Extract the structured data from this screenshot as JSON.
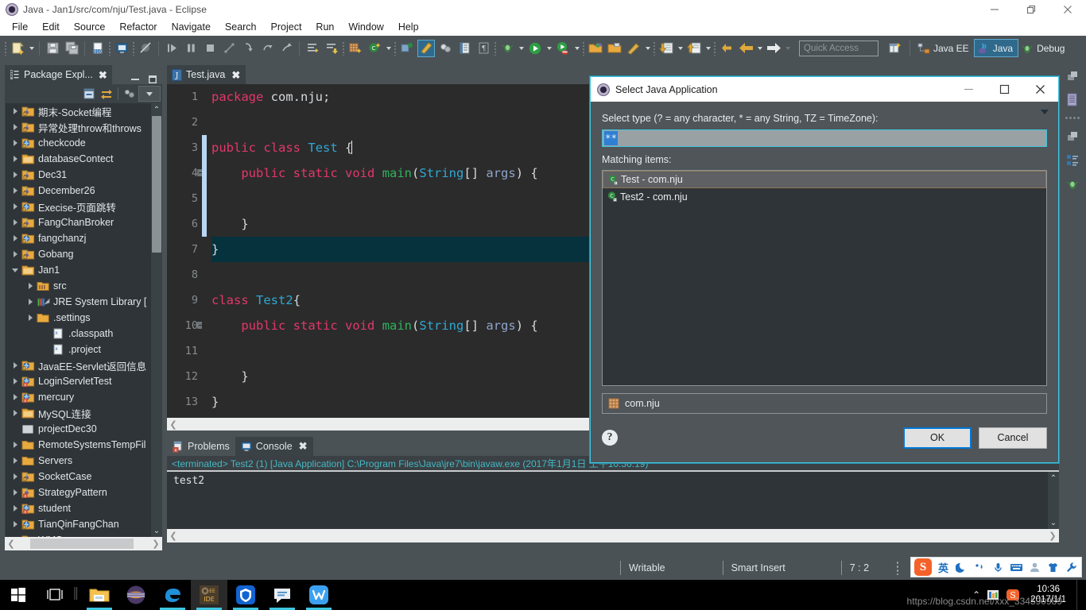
{
  "window": {
    "title": "Java - Jan1/src/com/nju/Test.java - Eclipse",
    "icon": "eclipse-icon",
    "minimize": "minimize-icon",
    "restore": "restore-icon",
    "close": "close-icon"
  },
  "menubar": {
    "items": [
      "File",
      "Edit",
      "Source",
      "Refactor",
      "Navigate",
      "Search",
      "Project",
      "Run",
      "Window",
      "Help"
    ]
  },
  "toolbar": {
    "quick_access_placeholder": "Quick Access",
    "perspectives": [
      {
        "label": "Java EE",
        "icon": "javaee-perspective-icon",
        "active": false
      },
      {
        "label": "Java",
        "icon": "java-perspective-icon",
        "active": true
      },
      {
        "label": "Debug",
        "icon": "debug-perspective-icon",
        "active": false
      }
    ],
    "open_perspective_icon": "open-perspective-icon"
  },
  "package_explorer": {
    "tab_label": "Package Expl...",
    "tab_icon": "package-explorer-icon",
    "close_icon": "close-icon",
    "minimize_icon": "minimize-icon",
    "maximize_icon": "maximize-icon",
    "tools": [
      "collapse-all-icon",
      "link-with-editor-icon",
      "view-menu-icon",
      "view-dropdown-icon"
    ],
    "tree": [
      {
        "label": "期末-Socket编程",
        "icon": "java-project-icon",
        "indent": 0,
        "expandable": true,
        "expanded": false
      },
      {
        "label": "异常处理throw和throws",
        "icon": "java-project-icon",
        "indent": 0,
        "expandable": true,
        "expanded": false
      },
      {
        "label": "checkcode",
        "icon": "web-project-icon",
        "indent": 0,
        "expandable": true,
        "expanded": false
      },
      {
        "label": "databaseContect",
        "icon": "folder-project-icon",
        "indent": 0,
        "expandable": true,
        "expanded": false
      },
      {
        "label": "Dec31",
        "icon": "java-project-icon",
        "indent": 0,
        "expandable": true,
        "expanded": false
      },
      {
        "label": "December26",
        "icon": "java-project-icon",
        "indent": 0,
        "expandable": true,
        "expanded": false
      },
      {
        "label": "Execise-页面跳转",
        "icon": "web-project-icon",
        "indent": 0,
        "expandable": true,
        "expanded": false
      },
      {
        "label": "FangChanBroker",
        "icon": "java-project-icon",
        "indent": 0,
        "expandable": true,
        "expanded": false
      },
      {
        "label": "fangchanzj",
        "icon": "web-project-icon",
        "indent": 0,
        "expandable": true,
        "expanded": false
      },
      {
        "label": "Gobang",
        "icon": "java-project-icon",
        "indent": 0,
        "expandable": true,
        "expanded": false
      },
      {
        "label": "Jan1",
        "icon": "folder-project-icon",
        "indent": 0,
        "expandable": true,
        "expanded": true
      },
      {
        "label": "src",
        "icon": "source-folder-icon",
        "indent": 1,
        "expandable": true,
        "expanded": false
      },
      {
        "label": "JRE System Library [",
        "icon": "jre-library-icon",
        "indent": 1,
        "expandable": true,
        "expanded": false
      },
      {
        "label": ".settings",
        "icon": "folder-icon",
        "indent": 1,
        "expandable": true,
        "expanded": false
      },
      {
        "label": ".classpath",
        "icon": "xml-file-icon",
        "indent": 2,
        "expandable": false,
        "expanded": false
      },
      {
        "label": ".project",
        "icon": "xml-file-icon",
        "indent": 2,
        "expandable": false,
        "expanded": false
      },
      {
        "label": "JavaEE-Servlet返回信息",
        "icon": "web-project-icon",
        "indent": 0,
        "expandable": true,
        "expanded": false
      },
      {
        "label": "LoginServletTest",
        "icon": "web-error-project-icon",
        "indent": 0,
        "expandable": true,
        "expanded": false
      },
      {
        "label": "mercury",
        "icon": "web-error-project-icon",
        "indent": 0,
        "expandable": true,
        "expanded": false
      },
      {
        "label": "MySQL连接",
        "icon": "folder-project-icon",
        "indent": 0,
        "expandable": true,
        "expanded": false
      },
      {
        "label": "projectDec30",
        "icon": "closed-project-icon",
        "indent": 0,
        "expandable": false,
        "expanded": false
      },
      {
        "label": "RemoteSystemsTempFil",
        "icon": "folder-icon",
        "indent": 0,
        "expandable": true,
        "expanded": false
      },
      {
        "label": "Servers",
        "icon": "folder-icon",
        "indent": 0,
        "expandable": true,
        "expanded": false
      },
      {
        "label": "SocketCase",
        "icon": "java-project-icon",
        "indent": 0,
        "expandable": true,
        "expanded": false
      },
      {
        "label": "StrategyPattern",
        "icon": "java-error-project-icon",
        "indent": 0,
        "expandable": true,
        "expanded": false
      },
      {
        "label": "student",
        "icon": "web-error-project-icon",
        "indent": 0,
        "expandable": true,
        "expanded": false
      },
      {
        "label": "TianQinFangChan",
        "icon": "web-project-icon",
        "indent": 0,
        "expandable": true,
        "expanded": false
      },
      {
        "label": "WMS",
        "icon": "web-project-icon",
        "indent": 0,
        "expandable": true,
        "expanded": false
      }
    ]
  },
  "editor": {
    "tab_label": "Test.java",
    "tab_icon": "java-file-icon",
    "close_icon": "close-icon",
    "current_line": 7,
    "lines": [
      {
        "n": "1",
        "tokens": [
          {
            "t": "package",
            "c": "kw"
          },
          {
            "t": " com.nju;",
            "c": "pl"
          }
        ]
      },
      {
        "n": "2",
        "tokens": []
      },
      {
        "n": "3",
        "tokens": [
          {
            "t": "public",
            "c": "kw"
          },
          {
            "t": " ",
            "c": "pl"
          },
          {
            "t": "class",
            "c": "kw"
          },
          {
            "t": " ",
            "c": "pl"
          },
          {
            "t": "Test",
            "c": "cls"
          },
          {
            "t": " {",
            "c": "pl"
          }
        ]
      },
      {
        "n": "4",
        "fold": true,
        "tokens": [
          {
            "t": "    ",
            "c": "pl"
          },
          {
            "t": "public",
            "c": "kw"
          },
          {
            "t": " ",
            "c": "pl"
          },
          {
            "t": "static",
            "c": "kw"
          },
          {
            "t": " ",
            "c": "pl"
          },
          {
            "t": "void",
            "c": "kw"
          },
          {
            "t": " ",
            "c": "pl"
          },
          {
            "t": "main",
            "c": "mth"
          },
          {
            "t": "(",
            "c": "pl"
          },
          {
            "t": "String",
            "c": "cls"
          },
          {
            "t": "[] ",
            "c": "pl"
          },
          {
            "t": "args",
            "c": "prm"
          },
          {
            "t": ") {",
            "c": "pl"
          }
        ]
      },
      {
        "n": "5",
        "tokens": []
      },
      {
        "n": "6",
        "tokens": [
          {
            "t": "    }",
            "c": "pl"
          }
        ]
      },
      {
        "n": "7",
        "tokens": [
          {
            "t": "}",
            "c": "pl"
          }
        ]
      },
      {
        "n": "8",
        "tokens": []
      },
      {
        "n": "9",
        "tokens": [
          {
            "t": "class",
            "c": "kw"
          },
          {
            "t": " ",
            "c": "pl"
          },
          {
            "t": "Test2",
            "c": "cls"
          },
          {
            "t": "{",
            "c": "pl"
          }
        ]
      },
      {
        "n": "10",
        "fold": true,
        "tokens": [
          {
            "t": "    ",
            "c": "pl"
          },
          {
            "t": "public",
            "c": "kw"
          },
          {
            "t": " ",
            "c": "pl"
          },
          {
            "t": "static",
            "c": "kw"
          },
          {
            "t": " ",
            "c": "pl"
          },
          {
            "t": "void",
            "c": "kw"
          },
          {
            "t": " ",
            "c": "pl"
          },
          {
            "t": "main",
            "c": "mth"
          },
          {
            "t": "(",
            "c": "pl"
          },
          {
            "t": "String",
            "c": "cls"
          },
          {
            "t": "[] ",
            "c": "pl"
          },
          {
            "t": "args",
            "c": "prm"
          },
          {
            "t": ") {",
            "c": "pl"
          }
        ]
      },
      {
        "n": "11",
        "tokens": []
      },
      {
        "n": "12",
        "tokens": [
          {
            "t": "    }",
            "c": "pl"
          }
        ]
      },
      {
        "n": "13",
        "tokens": [
          {
            "t": "}",
            "c": "pl"
          }
        ]
      }
    ]
  },
  "console": {
    "tabs": [
      {
        "label": "Problems",
        "icon": "problems-icon",
        "active": false
      },
      {
        "label": "Console",
        "icon": "console-icon",
        "active": true
      }
    ],
    "close_icon": "close-icon",
    "header": "<terminated> Test2 (1) [Java Application] C:\\Program Files\\Java\\jre7\\bin\\javaw.exe (2017年1月1日 上午10:36:19)",
    "output": "test2"
  },
  "right_toolbar": {
    "buttons": [
      "restore-view-icon",
      "outline-view-icon",
      "restore-view-icon-2",
      "task-list-icon",
      "debug-view-icon"
    ]
  },
  "statusbar": {
    "writable": "Writable",
    "insert_mode": "Smart Insert",
    "position": "7 : 2"
  },
  "ime": {
    "logo": "S",
    "mode": "英",
    "icons": [
      "moon-icon",
      "comma-icon",
      "mic-icon",
      "keyboard-icon",
      "user-icon",
      "skin-icon",
      "tools-icon"
    ]
  },
  "dialog": {
    "title": "Select Java Application",
    "icon": "eclipse-icon",
    "minimize": "minimize-icon",
    "maximize": "maximize-icon",
    "close": "close-icon",
    "prompt": "Select type (? = any character, * = any String, TZ = TimeZone):",
    "filter_value": "**",
    "matching_label": "Matching items:",
    "items": [
      {
        "label": "Test - com.nju",
        "icon": "java-class-run-icon",
        "selected": true
      },
      {
        "label": "Test2 - com.nju",
        "icon": "java-class-run-icon",
        "selected": false
      }
    ],
    "package_label": "com.nju",
    "package_icon": "package-icon",
    "help_icon": "help-icon",
    "ok_label": "OK",
    "cancel_label": "Cancel"
  },
  "taskbar": {
    "items": [
      {
        "name": "start-button",
        "icon": "windows-logo-icon"
      },
      {
        "name": "task-view-button",
        "icon": "task-view-icon"
      },
      {
        "name": "separator",
        "icon": "separator-icon"
      },
      {
        "name": "file-explorer-button",
        "icon": "file-explorer-icon"
      },
      {
        "name": "eclipse-taskbar-button",
        "icon": "eclipse-ring-icon"
      },
      {
        "name": "edge-button",
        "icon": "edge-icon"
      },
      {
        "name": "jmp-ide-button",
        "icon": "jmp-ide-icon"
      },
      {
        "name": "tencent-button",
        "icon": "tencent-shield-icon"
      },
      {
        "name": "qq-button",
        "icon": "chat-icon"
      },
      {
        "name": "wps-button",
        "icon": "wps-icon"
      }
    ],
    "tray_chevron": "show-hidden-icons-icon",
    "clock_time": "10:36",
    "clock_date": "2017/1/1",
    "watermark": "https://blog.csdn.net/xxx_334590989"
  }
}
